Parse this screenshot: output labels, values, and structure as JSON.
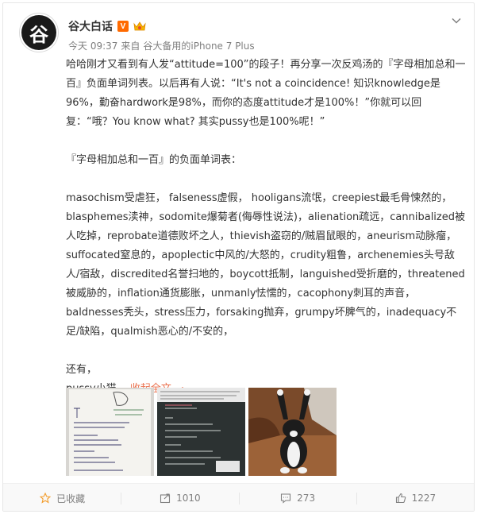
{
  "user": {
    "name": "谷大白话",
    "avatar_glyph": "谷",
    "vip_badge": "V",
    "time": "今天 09:37",
    "source_prefix": "来自",
    "source": "谷大备用的iPhone 7 Plus"
  },
  "post": {
    "para1": "哈哈刚才又看到有人发“attitude=100”的段子！再分享一次反鸡汤的『字母相加总和一百』负面单词列表。以后再有人说：“It's not a coincidence! 知识knowledge是96%，勤奋hardwork是98%，而你的态度attitude才是100%！”你就可以回复：“哦？You know what? 其实pussy也是100%呢！”",
    "para2": "『字母相加总和一百』的负面单词表：",
    "para3": "masochism受虐狂， falseness虚假， hooligans流氓，creepiest最毛骨悚然的，blasphemes渎神，sodomite爆菊者(侮辱性说法)，alienation疏远，cannibalized被人吃掉，reprobate道德败坏之人，thievish盗窃的/贼眉鼠眼的，aneurism动脉瘤，suffocated窒息的，apoplectic中风的/大怒的，crudity粗鲁，archenemies头号敌人/宿敌，discredited名誉扫地的，boycott抵制，languished受折磨的，threatened被威胁的，inflation通货膨胀，unmanly怯懦的，cacophony刺耳的声音，baldnesses秃头，stress压力，forsaking抛弃，grumpy坏脾气的，inadequacy不足/缺陷，qualmish恶心的/不安的，",
    "para4_line1": "还有，",
    "para4_line2": "pussy小猫。",
    "collapse_label": "收起全文",
    "collapse_arrow": "^"
  },
  "actions": {
    "favorite": "已收藏",
    "repost": "1010",
    "comment": "273",
    "like": "1227"
  },
  "colors": {
    "link": "#eb7350",
    "muted": "#808080",
    "text": "#333333"
  }
}
